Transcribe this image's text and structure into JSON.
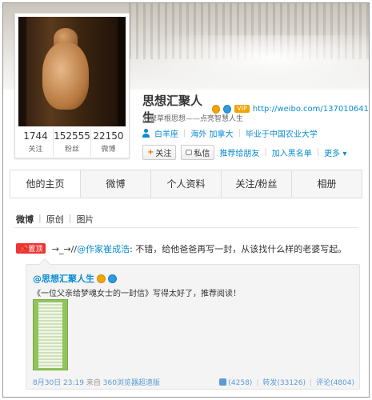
{
  "profile": {
    "name": "思想汇聚人生",
    "vip_label": "VIP",
    "url": "http://weibo.com/137010641",
    "tagline": "汇聚草根思想——点亮智慧人生",
    "info": [
      "白羊座",
      "海外 加拿大",
      "毕业于中国农业大学"
    ],
    "stats": [
      {
        "value": "1744",
        "label": "关注"
      },
      {
        "value": "152555",
        "label": "粉丝"
      },
      {
        "value": "22150",
        "label": "微博"
      }
    ],
    "actions": {
      "follow": "关注",
      "message": "私信",
      "recommend": "推荐给朋友",
      "blacklist": "加入黑名单",
      "more": "更多 ▾"
    }
  },
  "tabs": [
    "他的主页",
    "微博",
    "个人资料",
    "关注/粉丝",
    "相册"
  ],
  "subtabs": [
    "微博",
    "原创",
    "图片"
  ],
  "post": {
    "pin_label": "置顶",
    "prefix": "→_→//",
    "mention": "@作家崔成浩",
    "text": ": 不错，给他爸爸再写一封，从该找什么样的老婆写起。"
  },
  "repost": {
    "author": "@思想汇聚人生",
    "text": "《一位父亲给梦魂女士的一封信》写得太好了，推荐阅读！",
    "date": "8月30日 23:19",
    "source_prefix": "来自",
    "source": "360浏览器超速版",
    "likes": "(4258)",
    "forward": "转发(33126)",
    "comment": "评论(4804)"
  },
  "colors": {
    "link": "#0a8cd2",
    "pin": "#ee3333",
    "vip": "#f5a200"
  }
}
